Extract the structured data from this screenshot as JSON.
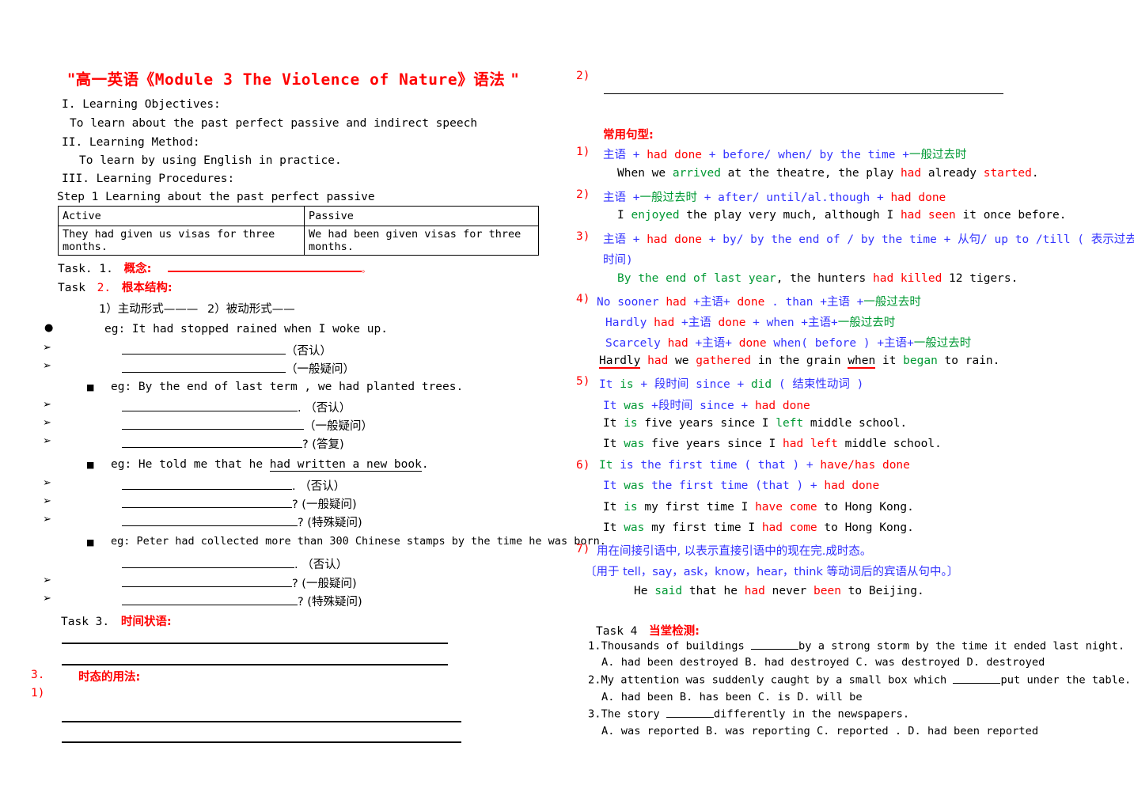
{
  "doc": {
    "title_quote_open": "\"",
    "title_cn1": "高一英语《",
    "title_en": "Module 3  The Violence of Nature",
    "title_cn2": "》语法 ",
    "title_quote_close": "\""
  },
  "left": {
    "objectives_head": "I.   Learning Objectives:",
    "objectives_body": "To learn about the past perfect passive and indirect speech",
    "method_head": "II.   Learning Method:",
    "method_body": "To learn by using English in practice.",
    "procedures_head": "III. Learning Procedures:",
    "step1": "Step 1 Learning about the past perfect passive",
    "table": {
      "headers": [
        "Active",
        "Passive"
      ],
      "rows": [
        [
          "They had given us visas for three months.",
          "We had been given visas for three months."
        ]
      ]
    },
    "task1_label": "Task. 1.",
    "task1_title": "概念:",
    "task1_period": "。",
    "task2_label": "Task",
    "task2_num": "2.",
    "task2_title": "根本结构:",
    "form_active": "1）主动形式———",
    "form_passive": "2）被动形式——",
    "eg1": "eg:  It had stopped rained when I woke up.",
    "eg1_a": "（否认）",
    "eg1_b": "（一般疑问）",
    "eg2": "eg:  By the end of last term , we had planted  trees.",
    "eg2_a": ". （否认）",
    "eg2_b": "（一般疑问）",
    "eg2_c": "? (答复)",
    "eg3_pre": "eg:  He told me that he ",
    "eg3_u": "had written a new book",
    "eg3_post": ".",
    "eg3_a": ". （否认）",
    "eg3_b": "? (一般疑问)",
    "eg3_c": "?  (特殊疑问)",
    "eg4": "eg:  Peter had collected more than 300 Chinese stamps by the time he was born.",
    "eg4_a": ". （否认）",
    "eg4_b": "? (一般疑问)",
    "eg4_c": "?  (特殊疑问)",
    "task3_label": "Task  3.",
    "task3_title": "时间状语:",
    "sec3_num": "3.",
    "sec3_title": "时态的用法:",
    "sec3_item1": "1)"
  },
  "right": {
    "item2_marker": "2)",
    "common_patterns_head": "常用句型:",
    "patterns": [
      {
        "num": "1)",
        "parts": [
          {
            "text": "主语",
            "color": "blue"
          },
          {
            "text": " + ",
            "color": "blue"
          },
          {
            "text": "had  done",
            "color": "red"
          },
          {
            "text": " + ",
            "color": "blue"
          },
          {
            "text": "before/ when/ by the time",
            "color": "blue"
          },
          {
            "text": " +",
            "color": "blue"
          },
          {
            "text": "一般过去时",
            "color": "green"
          }
        ],
        "example": [
          {
            "text": "When we ",
            "color": "black"
          },
          {
            "text": "arrived",
            "color": "green"
          },
          {
            "text": " at the theatre, the play ",
            "color": "black"
          },
          {
            "text": "had",
            "color": "red"
          },
          {
            "text": " already ",
            "color": "black"
          },
          {
            "text": "started",
            "color": "red"
          },
          {
            "text": ".",
            "color": "black"
          }
        ]
      },
      {
        "num": "2)",
        "parts": [
          {
            "text": "主语",
            "color": "blue"
          },
          {
            "text": " +",
            "color": "blue"
          },
          {
            "text": "一般过去时",
            "color": "green"
          },
          {
            "text": " + ",
            "color": "blue"
          },
          {
            "text": "after/ until/al.though",
            "color": "blue"
          },
          {
            "text": " + ",
            "color": "blue"
          },
          {
            "text": "had  done",
            "color": "red"
          }
        ],
        "example": [
          {
            "text": "I ",
            "color": "black"
          },
          {
            "text": "enjoyed",
            "color": "green"
          },
          {
            "text": " the play very much, although I ",
            "color": "black"
          },
          {
            "text": "had  seen",
            "color": "red"
          },
          {
            "text": " it once before.",
            "color": "black"
          }
        ]
      },
      {
        "num": "3)",
        "parts": [
          {
            "text": "主语",
            "color": "blue"
          },
          {
            "text": " + ",
            "color": "blue"
          },
          {
            "text": "had done",
            "color": "red"
          },
          {
            "text": "  + by/ by the end of / by the time + ",
            "color": "blue"
          },
          {
            "text": "从句/  up to /till",
            "color": "blue"
          },
          {
            "text": " ( 表示过去时间)",
            "color": "blue"
          }
        ],
        "example": [
          {
            "text": "By the end of last year",
            "color": "green"
          },
          {
            "text": ", the hunters ",
            "color": "black"
          },
          {
            "text": "had killed",
            "color": "red"
          },
          {
            "text": " 12 tigers.",
            "color": "black"
          }
        ]
      },
      {
        "num": "4)",
        "parts": [
          {
            "text": "No sooner ",
            "color": "blue"
          },
          {
            "text": "had",
            "color": "red"
          },
          {
            "text": " +",
            "color": "blue"
          },
          {
            "text": "主语",
            "color": "blue"
          },
          {
            "text": "+ ",
            "color": "blue"
          },
          {
            "text": "done",
            "color": "red"
          },
          {
            "text": "  .",
            "color": "blue"
          },
          {
            "text": " than +",
            "color": "blue"
          },
          {
            "text": "主语",
            "color": "blue"
          },
          {
            "text": " +",
            "color": "blue"
          },
          {
            "text": "一般过去时",
            "color": "green"
          }
        ],
        "extra_lines": [
          [
            {
              "text": "Hardly ",
              "color": "blue"
            },
            {
              "text": "had",
              "color": "red"
            },
            {
              "text": " +",
              "color": "blue"
            },
            {
              "text": "主语",
              "color": "blue"
            },
            {
              "text": " ",
              "color": "blue"
            },
            {
              "text": "done",
              "color": "red"
            },
            {
              "text": " + when +",
              "color": "blue"
            },
            {
              "text": "主语",
              "color": "blue"
            },
            {
              "text": "+",
              "color": "blue"
            },
            {
              "text": "一般过去时",
              "color": "green"
            }
          ],
          [
            {
              "text": "Scarcely ",
              "color": "blue"
            },
            {
              "text": "had",
              "color": "red"
            },
            {
              "text": " +",
              "color": "blue"
            },
            {
              "text": "主语",
              "color": "blue"
            },
            {
              "text": "+ ",
              "color": "blue"
            },
            {
              "text": "done",
              "color": "red"
            },
            {
              "text": " when( ",
              "color": "blue"
            },
            {
              "text": "before",
              "color": "blue"
            },
            {
              "text": " ) +",
              "color": "blue"
            },
            {
              "text": "主语",
              "color": "blue"
            },
            {
              "text": "+",
              "color": "blue"
            },
            {
              "text": "一般过去时",
              "color": "green"
            }
          ]
        ],
        "example": [
          {
            "text": "Hardly",
            "color": "black",
            "underline_red": true
          },
          {
            "text": " ",
            "color": "black"
          },
          {
            "text": "had",
            "color": "red"
          },
          {
            "text": " we ",
            "color": "black"
          },
          {
            "text": "gathered",
            "color": "red"
          },
          {
            "text": " in the grain ",
            "color": "black"
          },
          {
            "text": "when",
            "color": "black",
            "underline_red": true
          },
          {
            "text": " it ",
            "color": "black"
          },
          {
            "text": "began",
            "color": "green"
          },
          {
            "text": " to rain.",
            "color": "black"
          }
        ]
      },
      {
        "num": "5)",
        "parts": [
          {
            "text": "It ",
            "color": "blue"
          },
          {
            "text": "is",
            "color": "green"
          },
          {
            "text": " + ",
            "color": "blue"
          },
          {
            "text": " 段时间",
            "color": "blue"
          },
          {
            "text": "     since + ",
            "color": "blue"
          },
          {
            "text": "did",
            "color": "green"
          },
          {
            "text": " ( 结束性动词 )",
            "color": "blue"
          }
        ],
        "extra_lines": [
          [
            {
              "text": "It ",
              "color": "blue"
            },
            {
              "text": "was",
              "color": "green"
            },
            {
              "text": " +",
              "color": "blue"
            },
            {
              "text": "段时间",
              "color": "blue"
            },
            {
              "text": "     since + ",
              "color": "blue"
            },
            {
              "text": "had done",
              "color": "red"
            }
          ]
        ],
        "example": [
          {
            "text": "It ",
            "color": "black"
          },
          {
            "text": "is",
            "color": "green"
          },
          {
            "text": " five years since I ",
            "color": "black"
          },
          {
            "text": "left",
            "color": "green"
          },
          {
            "text": " middle school.",
            "color": "black"
          }
        ],
        "example2": [
          {
            "text": "It ",
            "color": "black"
          },
          {
            "text": "was",
            "color": "green"
          },
          {
            "text": " five years since I ",
            "color": "black"
          },
          {
            "text": "had left",
            "color": "red"
          },
          {
            "text": " middle school.",
            "color": "black"
          }
        ]
      },
      {
        "num": "6)",
        "parts": [
          {
            "text": "It ",
            "color": "green"
          },
          {
            "text": "is the first time ( that )",
            "color": "blue"
          },
          {
            "text": "   + ",
            "color": "blue"
          },
          {
            "text": "have/has done",
            "color": "red"
          }
        ],
        "extra_lines": [
          [
            {
              "text": "It ",
              "color": "blue"
            },
            {
              "text": "was",
              "color": "green"
            },
            {
              "text": " the first time (that )",
              "color": "blue"
            },
            {
              "text": "   + ",
              "color": "blue"
            },
            {
              "text": "had done",
              "color": "red"
            }
          ]
        ],
        "example": [
          {
            "text": "It ",
            "color": "black"
          },
          {
            "text": "is",
            "color": "green"
          },
          {
            "text": " my first time I ",
            "color": "black"
          },
          {
            "text": "have come",
            "color": "red"
          },
          {
            "text": " to Hong Kong.",
            "color": "black"
          }
        ],
        "example2": [
          {
            "text": "It ",
            "color": "black"
          },
          {
            "text": "was",
            "color": "green"
          },
          {
            "text": " my first time I ",
            "color": "black"
          },
          {
            "text": "had come",
            "color": "red"
          },
          {
            "text": " to Hong Kong.",
            "color": "black"
          }
        ]
      },
      {
        "num": "7)",
        "parts": [
          {
            "text": "用在间接引语中, 以表示直接引语中的现在完.成时态。",
            "color": "blue"
          }
        ],
        "note": "〔用于 tell，say，ask，know，hear，think 等动词后的宾语从句中。〕",
        "example": [
          {
            "text": "He ",
            "color": "black"
          },
          {
            "text": "said",
            "color": "green"
          },
          {
            "text": " that he ",
            "color": "black"
          },
          {
            "text": "had",
            "color": "red"
          },
          {
            "text": " never ",
            "color": "black"
          },
          {
            "text": "been",
            "color": "red"
          },
          {
            "text": " to Beijing.",
            "color": "black"
          }
        ]
      }
    ],
    "task4_label": "Task 4",
    "task4_title": "当堂检测:",
    "questions": [
      {
        "num": "1.",
        "stem_pre": "Thousands of buildings ",
        "stem_post": "by a strong storm by the time it ended last night.",
        "options": "A. had been destroyed  B. had destroyed  C. was destroyed  D. destroyed"
      },
      {
        "num": "2.",
        "stem_pre": "My attention was suddenly caught by a small box which ",
        "stem_post": "put under the table.",
        "options": "A. had been            B. has been      C. is             D. will be"
      },
      {
        "num": "3.",
        "stem_pre": "The story ",
        "stem_post": "differently in the newspapers.",
        "options": "A. was reported        B. was reporting  C. reported .  D. had been reported"
      }
    ]
  },
  "colors": {
    "accent_red": "#ff0000",
    "accent_blue": "#3333ff",
    "accent_green": "#009933",
    "text_black": "#000000"
  }
}
